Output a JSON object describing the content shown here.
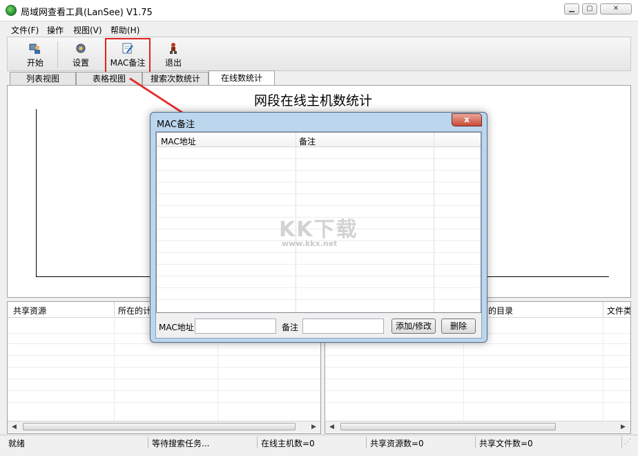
{
  "window": {
    "title": "局域网查看工具(LanSee) V1.75",
    "minimize_icon": "minimize-icon",
    "maximize_icon": "maximize-icon",
    "close_icon": "close-icon"
  },
  "menu": {
    "file": "文件(F)",
    "operate": "操作",
    "view": "视图(V)",
    "help": "帮助(H)"
  },
  "toolbar": {
    "start_label": "开始",
    "settings_label": "设置",
    "mac_note_label": "MAC备注",
    "exit_label": "退出",
    "icons": {
      "start": "computer-user-icon",
      "settings": "gear-icon",
      "mac_note": "notepad-edit-icon",
      "exit": "exit-person-icon"
    }
  },
  "tabs": [
    "列表视图",
    "表格视图",
    "搜索次数统计",
    "在线数统计"
  ],
  "active_tab": "在线数统计",
  "chart": {
    "title": "网段在线主机数统计"
  },
  "left_list": {
    "columns": [
      "共享资源",
      "所在的计"
    ]
  },
  "right_list": {
    "columns": [
      "的目录",
      "文件类"
    ]
  },
  "status": {
    "ready": "就绪",
    "waiting": "等待搜索任务...",
    "online_hosts": "在线主机数=0",
    "shared_resources": "共享资源数=0",
    "shared_files": "共享文件数=0"
  },
  "dialog": {
    "title": "MAC备注",
    "close_label": "x",
    "columns": [
      "MAC地址",
      "备注"
    ],
    "mac_label": "MAC地址",
    "note_label": "备注",
    "mac_value": "",
    "note_value": "",
    "add_modify_button": "添加/修改",
    "delete_button": "删除"
  },
  "watermark": {
    "logo": "KK下载",
    "url": "www.kkx.net"
  },
  "colors": {
    "highlight": "#e02020",
    "arrow": "#e53030",
    "dialog_frame": "#bcd6ee",
    "dialog_close": "#c94a36"
  }
}
